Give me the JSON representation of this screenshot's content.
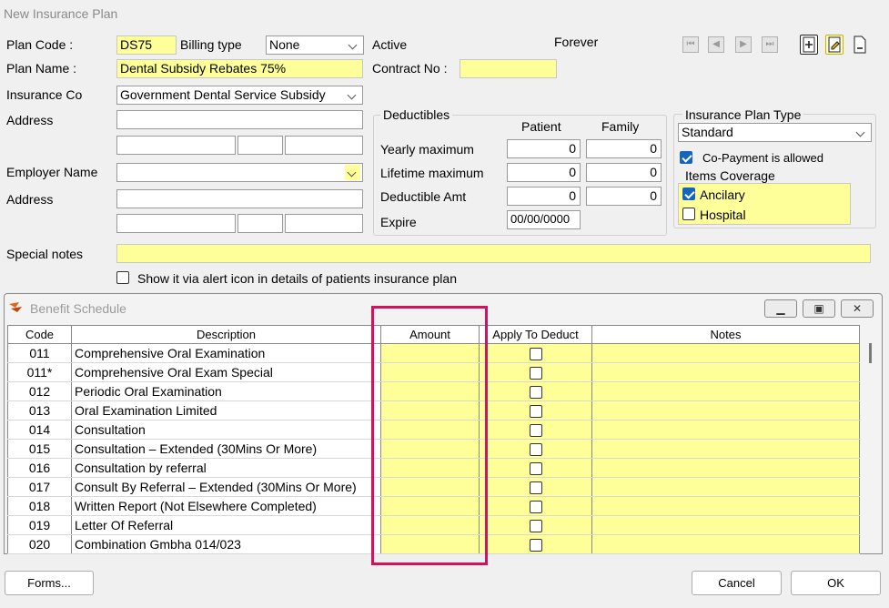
{
  "window": {
    "title": "New Insurance Plan"
  },
  "plan": {
    "code_label": "Plan Code :",
    "code_value": "DS75",
    "billing_label": "Billing type",
    "billing_value": "None",
    "active_label": "Active",
    "forever_label": "Forever",
    "name_label": "Plan Name :",
    "name_value": "Dental Subsidy Rebates 75%",
    "contract_label": "Contract No :",
    "contract_value": "",
    "insurance_label": "Insurance Co",
    "insurance_value": "Government Dental Service Subsidy",
    "address_label": "Address",
    "employer_label": "Employer Name",
    "employer_value": "",
    "employer_address_label": "Address",
    "special_label": "Special notes",
    "special_value": "",
    "alert_label": "Show it via alert icon in details of patients insurance plan"
  },
  "deductibles": {
    "title": "Deductibles",
    "col_patient": "Patient",
    "col_family": "Family",
    "rows": [
      {
        "label": "Yearly maximum",
        "patient": "0",
        "family": "0"
      },
      {
        "label": "Lifetime maximum",
        "patient": "0",
        "family": "0"
      },
      {
        "label": "Deductible Amt",
        "patient": "0",
        "family": "0"
      }
    ],
    "expire_label": "Expire",
    "expire_value": "00/00/0000"
  },
  "plan_type": {
    "title": "Insurance Plan Type",
    "value": "Standard",
    "copay_label": "Co-Payment is allowed"
  },
  "coverage": {
    "title": "Items Coverage",
    "items": [
      {
        "label": "Ancilary",
        "checked": true
      },
      {
        "label": "Hospital",
        "checked": false
      }
    ]
  },
  "benefit": {
    "title": "Benefit Schedule",
    "columns": [
      "Code",
      "Description",
      "Amount",
      "Apply To Deduct",
      "Notes"
    ],
    "rows": [
      {
        "code": "011",
        "desc": "Comprehensive Oral Examination"
      },
      {
        "code": "011*",
        "desc": "Comprehensive Oral Exam Special"
      },
      {
        "code": "012",
        "desc": "Periodic Oral Examination"
      },
      {
        "code": "013",
        "desc": "Oral Examination Limited"
      },
      {
        "code": "014",
        "desc": "Consultation"
      },
      {
        "code": "015",
        "desc": "Consultation – Extended (30Mins Or More)"
      },
      {
        "code": "016",
        "desc": "Consultation by referral"
      },
      {
        "code": "017",
        "desc": "Consult By Referral – Extended  (30Mins Or More)"
      },
      {
        "code": "018",
        "desc": "Written Report (Not Elsewhere Completed)"
      },
      {
        "code": "019",
        "desc": "Letter Of Referral"
      },
      {
        "code": "020",
        "desc": "Combination Gmbha 014/023"
      }
    ]
  },
  "buttons": {
    "forms": "Forms...",
    "cancel": "Cancel",
    "ok": "OK"
  },
  "colors": {
    "field_yellow": "#ffff99",
    "highlight": "#d0135f",
    "check_blue": "#1565c0"
  }
}
